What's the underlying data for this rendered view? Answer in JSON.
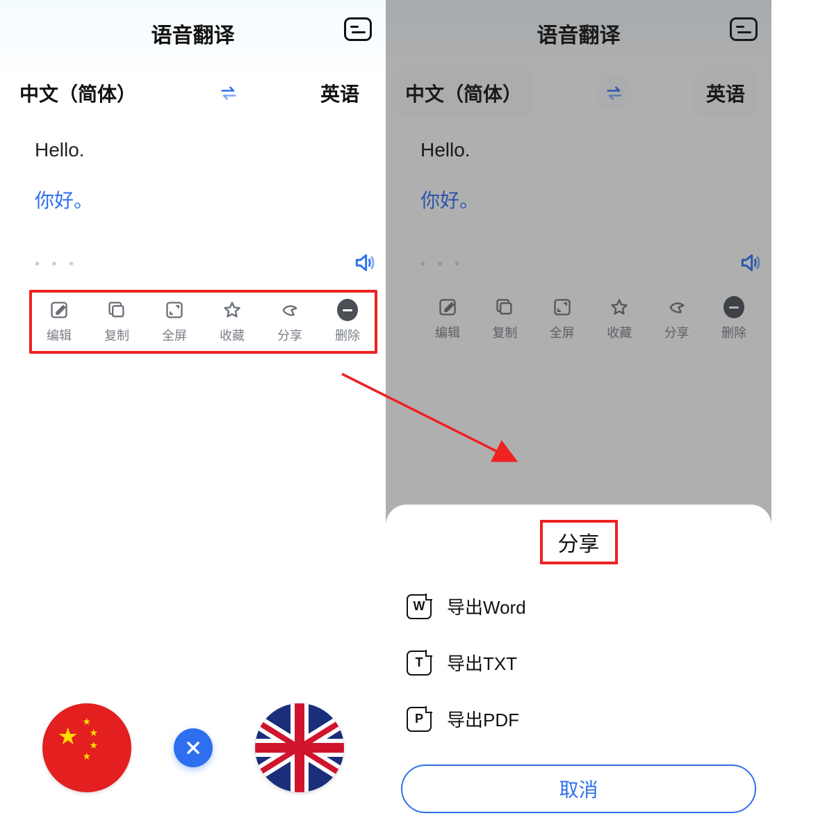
{
  "header": {
    "title": "语音翻译",
    "menu_icon": "list-toggle-icon"
  },
  "languages": {
    "source": "中文（简体）",
    "target": "英语",
    "swap_icon": "swap-icon"
  },
  "translation": {
    "source_text": "Hello.",
    "target_text": "你好。",
    "dots": "• • •",
    "speaker_icon": "speaker-icon"
  },
  "actions": [
    {
      "id": "edit",
      "label": "编辑",
      "icon": "edit-icon"
    },
    {
      "id": "copy",
      "label": "复制",
      "icon": "copy-icon"
    },
    {
      "id": "fullscreen",
      "label": "全屏",
      "icon": "fullscreen-icon"
    },
    {
      "id": "favorite",
      "label": "收藏",
      "icon": "star-icon"
    },
    {
      "id": "share",
      "label": "分享",
      "icon": "share-icon"
    },
    {
      "id": "delete",
      "label": "删除",
      "icon": "minus-circle-icon"
    }
  ],
  "bottom_controls": {
    "flag_source": "china-flag",
    "close_icon": "close-icon",
    "flag_target": "uk-flag"
  },
  "share_sheet": {
    "title": "分享",
    "options": [
      {
        "id": "word",
        "label": "导出Word",
        "glyph": "W"
      },
      {
        "id": "txt",
        "label": "导出TXT",
        "glyph": "T"
      },
      {
        "id": "pdf",
        "label": "导出PDF",
        "glyph": "P"
      }
    ],
    "cancel": "取消"
  },
  "colors": {
    "accent": "#2e6ff0",
    "highlight": "#ef2121"
  }
}
